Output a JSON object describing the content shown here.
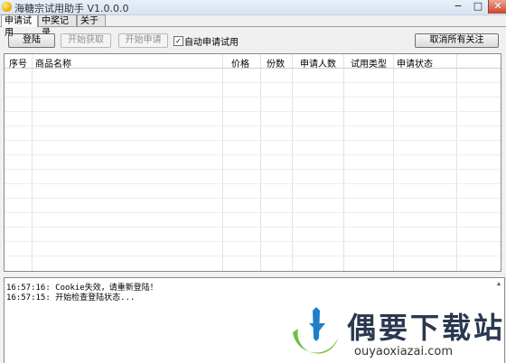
{
  "window": {
    "title": "海糖宗试用助手 V1.0.0.0",
    "min_glyph": "−",
    "max_glyph": "□",
    "close_glyph": "✕"
  },
  "tabs": [
    {
      "label": "申请试用",
      "active": true
    },
    {
      "label": "中奖记录",
      "active": false
    },
    {
      "label": "关于",
      "active": false
    }
  ],
  "toolbar": {
    "login_label": "登陆",
    "fetch_label": "开始获取",
    "apply_label": "开始申请",
    "auto_apply": {
      "label": "自动申请试用",
      "checked": true,
      "mark": "✓"
    },
    "unfollow_all_label": "取消所有关注"
  },
  "table": {
    "columns": [
      "序号",
      "商品名称",
      "价格",
      "份数",
      "申请人数",
      "试用类型",
      "申请状态"
    ],
    "rows": []
  },
  "log": {
    "lines": [
      "16:57:16: Cookie失效，请重新登陆！",
      "16:57:15: 开始检查登陆状态..."
    ],
    "scroll_glyph": "▲"
  },
  "watermark": {
    "title": "偶要下载站",
    "url": "ouyaoxiazai.com"
  }
}
